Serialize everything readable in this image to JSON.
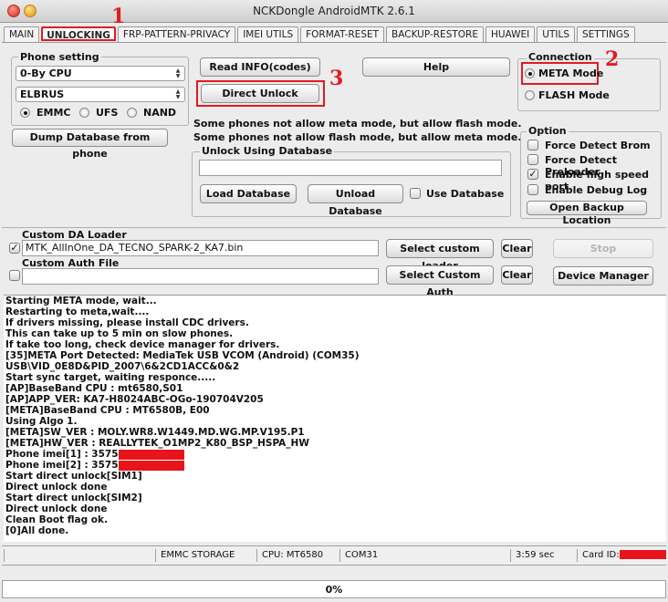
{
  "window": {
    "title": "NCKDongle AndroidMTK 2.6.1"
  },
  "tabs": [
    "MAIN",
    "UNLOCKING",
    "FRP-PATTERN-PRIVACY",
    "IMEI UTILS",
    "FORMAT-RESET",
    "BACKUP-RESTORE",
    "HUAWEI",
    "UTILS",
    "SETTINGS"
  ],
  "phone_setting": {
    "label": "Phone setting",
    "cpu": "0-By CPU",
    "model": "ELBRUS",
    "storage_options": [
      "EMMC",
      "UFS",
      "NAND"
    ],
    "storage_selected": "EMMC",
    "dump_button": "Dump Database from phone"
  },
  "actions": {
    "read_info": "Read INFO(codes)",
    "help": "Help",
    "direct_unlock": "Direct Unlock"
  },
  "notes": [
    "Some phones not allow meta mode, but allow flash mode.",
    "Some phones not allow flash mode, but allow meta mode."
  ],
  "database": {
    "label": "Unlock Using Database",
    "path": "",
    "load": "Load Database",
    "unload": "Unload Database",
    "use_label": "Use Database",
    "use_checked": false
  },
  "connection": {
    "label": "Connection",
    "options": [
      "META Mode",
      "FLASH Mode"
    ],
    "selected": "META Mode"
  },
  "option": {
    "label": "Option",
    "items": [
      {
        "label": "Force Detect Brom",
        "checked": false
      },
      {
        "label": "Force Detect Preloader",
        "checked": false
      },
      {
        "label": "Enable high speed port",
        "checked": true
      },
      {
        "label": "Enable Debug Log",
        "checked": false
      }
    ],
    "open_backup": "Open Backup Location"
  },
  "loader": {
    "da_label": "Custom DA Loader",
    "da_checked": true,
    "da_path": "MTK_AllInOne_DA_TECNO_SPARK-2_KA7.bin",
    "select_da": "Select custom loader",
    "clear": "Clear",
    "stop": "Stop",
    "auth_label": "Custom Auth File",
    "auth_path": "",
    "select_auth": "Select Custom Auth",
    "device_manager": "Device Manager"
  },
  "annotations": [
    "1",
    "2",
    "3"
  ],
  "log": [
    "Starting META mode, wait...",
    "Restarting to meta,wait....",
    "If drivers missing, please install CDC drivers.",
    "This can take up to 5 min on slow phones.",
    "If take too long, check device manager for drivers.",
    "[35]META Port Detected: MediaTek USB VCOM (Android) (COM35)",
    "USB\\VID_0E8D&PID_2007\\6&2CD1ACC&0&2",
    "Start sync target, waiting responce.....",
    "[AP]BaseBand CPU : mt6580,S01",
    "[AP]APP_VER: KA7-H8024ABC-OGo-190704V205",
    "[META]BaseBand CPU : MT6580B, E00",
    "Using Algo 1.",
    "[META]SW_VER : MOLY.WR8.W1449.MD.WG.MP.V195.P1",
    "[META]HW_VER : REALLYTEK_O1MP2_K80_BSP_HSPA_HW",
    "Phone imei[1] : 3575",
    "Phone imei[2] : 3575",
    "Start direct unlock[SIM1]",
    "Direct unlock done",
    "Start direct unlock[SIM2]",
    "Direct unlock done",
    "Clean Boot flag ok.",
    "[0]All done."
  ],
  "status": {
    "storage": "EMMC STORAGE",
    "cpu": "CPU: MT6580",
    "port": "COM31",
    "time": "3:59 sec",
    "card": "Card ID:"
  },
  "progress": {
    "value": 0,
    "label": "0%"
  },
  "colors": {
    "annotation": "#e01b24",
    "redaction": "#e8141c"
  }
}
